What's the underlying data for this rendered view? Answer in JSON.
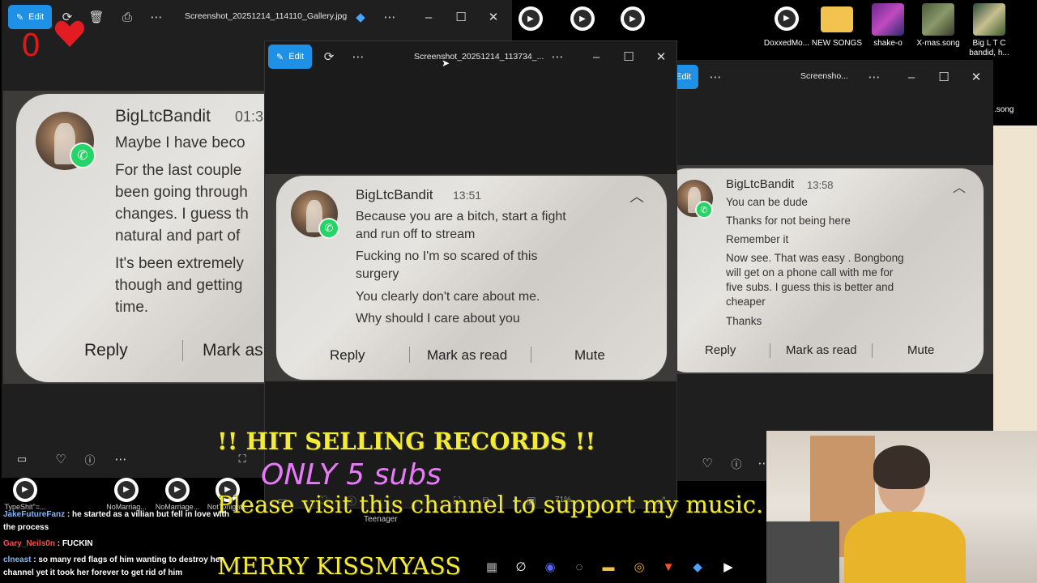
{
  "colors": {
    "accent": "#1e90e6",
    "overlay_yellow": "#f4ea3a",
    "overlay_pink": "#e879f9",
    "heart": "#e31b23",
    "counter": "#e01818",
    "whatsapp": "#25d366"
  },
  "counter": {
    "value": "0",
    "heart_icon": "heart-icon"
  },
  "left_window": {
    "edit_label": "Edit",
    "title": "Screenshot_20251214_114110_Gallery.jpg",
    "notification": {
      "sender": "BigLtcBandit",
      "time": "01:3",
      "messages": [
        "Maybe I have beco",
        "For the last couple",
        "been going through",
        "changes. I guess th",
        "natural and part of",
        "It's been extremely",
        "though and getting",
        "time."
      ],
      "reply": "Reply",
      "mark_read": "Mark as"
    }
  },
  "middle_window": {
    "edit_label": "Edit",
    "title": "Screenshot_20251214_113734_...",
    "zoom": "71%",
    "notification": {
      "sender": "BigLtcBandit",
      "time": "13:51",
      "messages": [
        "Because you are a bitch, start a fight",
        "and run off to stream",
        "Fucking no I'm so scared of this",
        "surgery",
        "You clearly don't care about me.",
        "Why should I care about you"
      ],
      "reply": "Reply",
      "mark_read": "Mark as read",
      "mute": "Mute"
    }
  },
  "right_window": {
    "edit_label": "Edit",
    "title": "Screensho...",
    "notification": {
      "sender": "BigLtcBandit",
      "time": "13:58",
      "messages": [
        "You can be dude",
        "Thanks for not being here",
        "Remember it",
        "Now see. That was easy . Bongbong",
        "will get on a phone call with me for",
        "five subs. I guess this is better and",
        "cheaper",
        "Thanks"
      ],
      "reply": "Reply",
      "mark_read": "Mark as read",
      "mute": "Mute"
    }
  },
  "desktop_icons": [
    {
      "label": "DoxxedMo..."
    },
    {
      "label": "NEW SONGS"
    },
    {
      "label": "shake-o"
    },
    {
      "label": "X-mas.song"
    },
    {
      "label": "Big L T C bandid, h..."
    }
  ],
  "right_edge_text": ".song",
  "bottom_icons": [
    {
      "label": "TypeShit\"=..."
    },
    {
      "label": "NoMarriag..."
    },
    {
      "label": "NoMarriage..."
    },
    {
      "label": "NotTonight..."
    }
  ],
  "teenager_label": "Teenager",
  "overlay": {
    "hit": "!! HIT SELLING RECORDS !!",
    "subs": "ONLY 5 subs",
    "visit": "Please visit this channel to support my music.",
    "merry": "MERRY KISSMYASS"
  },
  "chat": [
    {
      "user": "JakeFutureFanz",
      "text": ": he started as a villian but fell in love with the process",
      "color": "#7fb6ff"
    },
    {
      "user": "Gary_Neils0n",
      "text": ": FUCKIN",
      "color": "#ff4a4a"
    },
    {
      "user": "clneast",
      "text": ": so many red flags of him wanting to destroy her channel yet it took her forever to get rid of him",
      "color": "#7fb6ff"
    }
  ]
}
